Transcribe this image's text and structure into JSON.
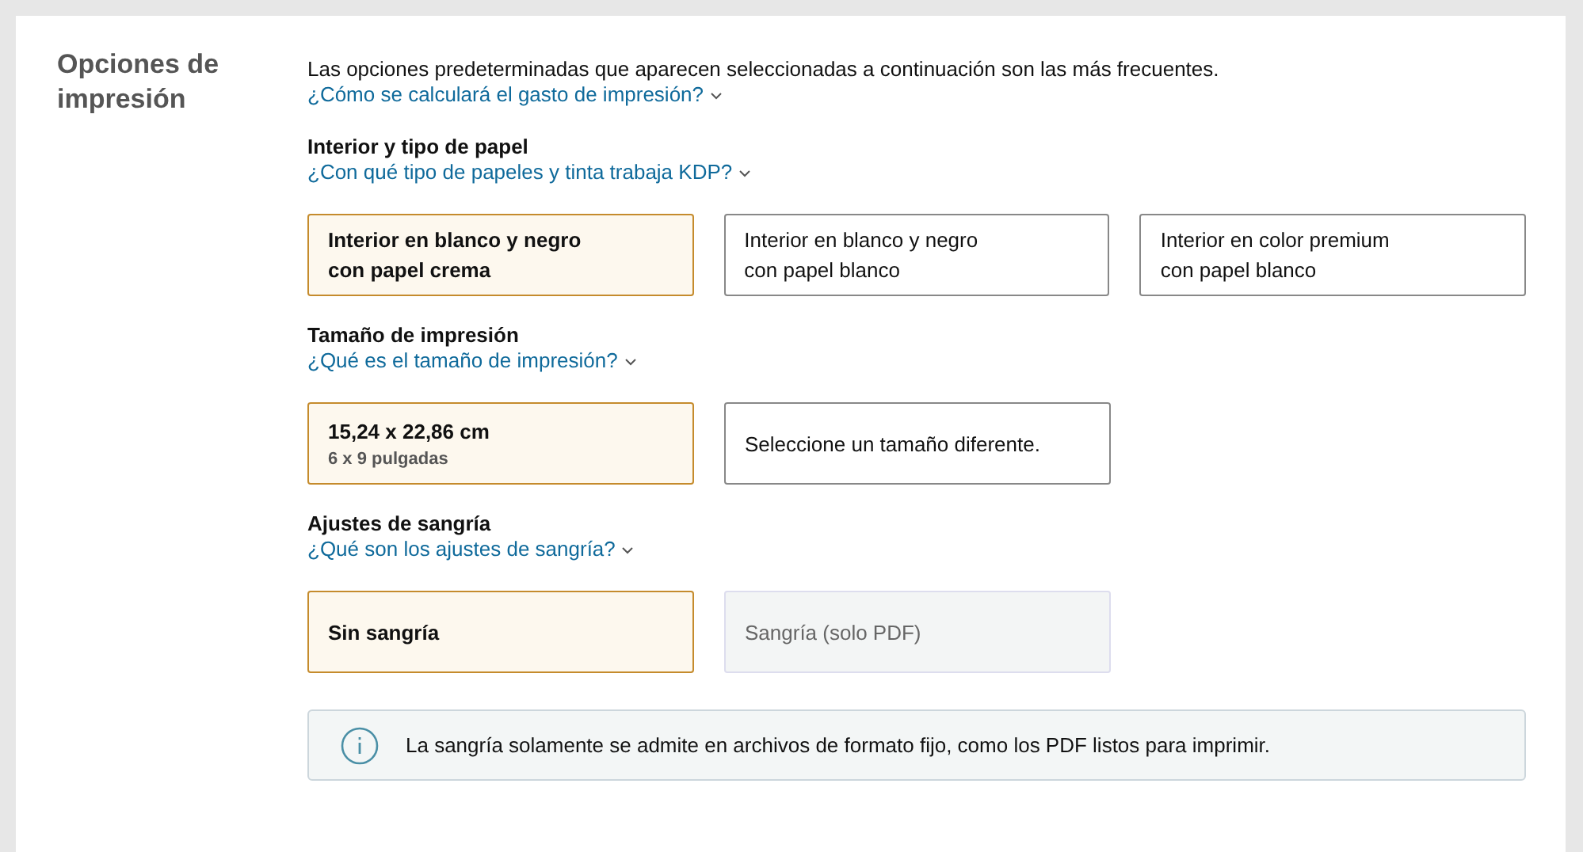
{
  "section_title": "Opciones de impresión",
  "intro": {
    "text": "Las opciones predeterminadas que aparecen seleccionadas a continuación son las más frecuentes.",
    "link": "¿Cómo se calculará el gasto de impresión?"
  },
  "groups": [
    {
      "title": "Interior y tipo de papel",
      "link": "¿Con qué tipo de papeles y tinta trabaja KDP?",
      "options": [
        {
          "lines": [
            "Interior en blanco y negro",
            "con papel crema"
          ],
          "selected": true,
          "disabled": false
        },
        {
          "lines": [
            "Interior en blanco y negro",
            "con papel blanco"
          ],
          "selected": false,
          "disabled": false
        },
        {
          "lines": [
            "Interior en color premium",
            "con papel blanco"
          ],
          "selected": false,
          "disabled": false
        }
      ]
    },
    {
      "title": "Tamaño de impresión",
      "link": "¿Qué es el tamaño de impresión?",
      "options": [
        {
          "lines": [
            "15,24 x 22,86 cm"
          ],
          "sub": "6 x 9 pulgadas",
          "selected": true,
          "disabled": false
        },
        {
          "lines": [
            "Seleccione un tamaño diferente."
          ],
          "selected": false,
          "disabled": false
        }
      ]
    },
    {
      "title": "Ajustes de sangría",
      "link": "¿Qué son los ajustes de sangría?",
      "options": [
        {
          "lines": [
            "Sin sangría"
          ],
          "selected": true,
          "disabled": false
        },
        {
          "lines": [
            "Sangría (solo PDF)"
          ],
          "selected": false,
          "disabled": true
        }
      ]
    }
  ],
  "notice": "La sangría solamente se admite en archivos de formato fijo, como los PDF listos para imprimir."
}
